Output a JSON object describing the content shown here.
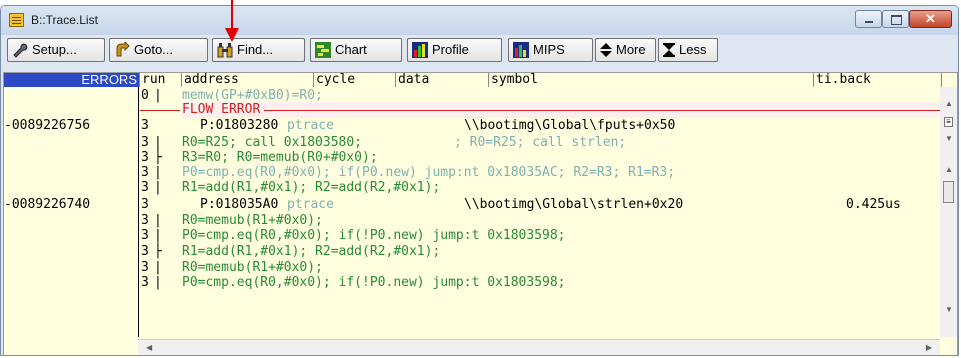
{
  "window": {
    "title": "B::Trace.List"
  },
  "toolbar": {
    "setup": "Setup...",
    "goto": "Goto...",
    "find": "Find...",
    "chart": "Chart",
    "profile": "Profile",
    "mips": "MIPS",
    "more": "More",
    "less": "Less"
  },
  "columns": {
    "errors": "ERRORS",
    "run": "run",
    "address": "address",
    "cycle": "cycle",
    "data": "data",
    "symbol": "symbol",
    "tiback": "ti.back"
  },
  "rows": [
    {
      "ts": "",
      "run": "0",
      "seg": "|",
      "text": "memw(GP+#0xB0)=R0;"
    },
    {
      "ts": "",
      "run": "",
      "seg": "",
      "text": "FLOW ERROR"
    },
    {
      "ts": "-0089226756",
      "run": "3",
      "seg": "",
      "addr": "P:01803280",
      "cyc": "ptrace",
      "sym": "\\\\bootimg\\Global\\fputs+0x50",
      "tiback": ""
    },
    {
      "ts": "",
      "run": "3",
      "seg": "|",
      "text": "R0=R25; call 0x1803580;",
      "comment": "; R0=R25; call strlen;"
    },
    {
      "ts": "",
      "run": "3",
      "seg": "├",
      "text": "R3=R0; R0=memub(R0+#0x0);"
    },
    {
      "ts": "",
      "run": "3",
      "seg": "|",
      "text": "P0=cmp.eq(R0,#0x0); if(P0.new) jump:nt 0x18035AC; R2=R3; R1=R3;"
    },
    {
      "ts": "",
      "run": "3",
      "seg": "|",
      "text": "R1=add(R1,#0x1); R2=add(R2,#0x1);"
    },
    {
      "ts": "-0089226740",
      "run": "3",
      "seg": "",
      "addr": "P:018035A0",
      "cyc": "ptrace",
      "sym": "\\\\bootimg\\Global\\strlen+0x20",
      "tiback": "0.425us"
    },
    {
      "ts": "",
      "run": "3",
      "seg": "|",
      "text": "R0=memub(R1+#0x0);"
    },
    {
      "ts": "",
      "run": "3",
      "seg": "|",
      "text": "P0=cmp.eq(R0,#0x0); if(!P0.new) jump:t 0x1803598;"
    },
    {
      "ts": "",
      "run": "3",
      "seg": "├",
      "text": "R1=add(R1,#0x1); R2=add(R2,#0x1);"
    },
    {
      "ts": "",
      "run": "3",
      "seg": "|",
      "text": "R0=memub(R1+#0x0);"
    },
    {
      "ts": "",
      "run": "3",
      "seg": "|",
      "text": "P0=cmp.eq(R0,#0x0); if(!P0.new) jump:t 0x1803598;"
    }
  ],
  "colors": {
    "header_errors_bg": "#2c49c6",
    "list_bg": "#ffffe0",
    "flow_error": "#d02020",
    "asm_text": "#2a8a36",
    "dimmed_text": "#7fb0b0",
    "callout_arrow": "#e00000"
  },
  "icons": [
    "wrench-icon",
    "goto-icon",
    "binoculars-icon",
    "chart-icon",
    "profile-icon",
    "mips-icon",
    "updown-icon",
    "hourglass-icon"
  ]
}
